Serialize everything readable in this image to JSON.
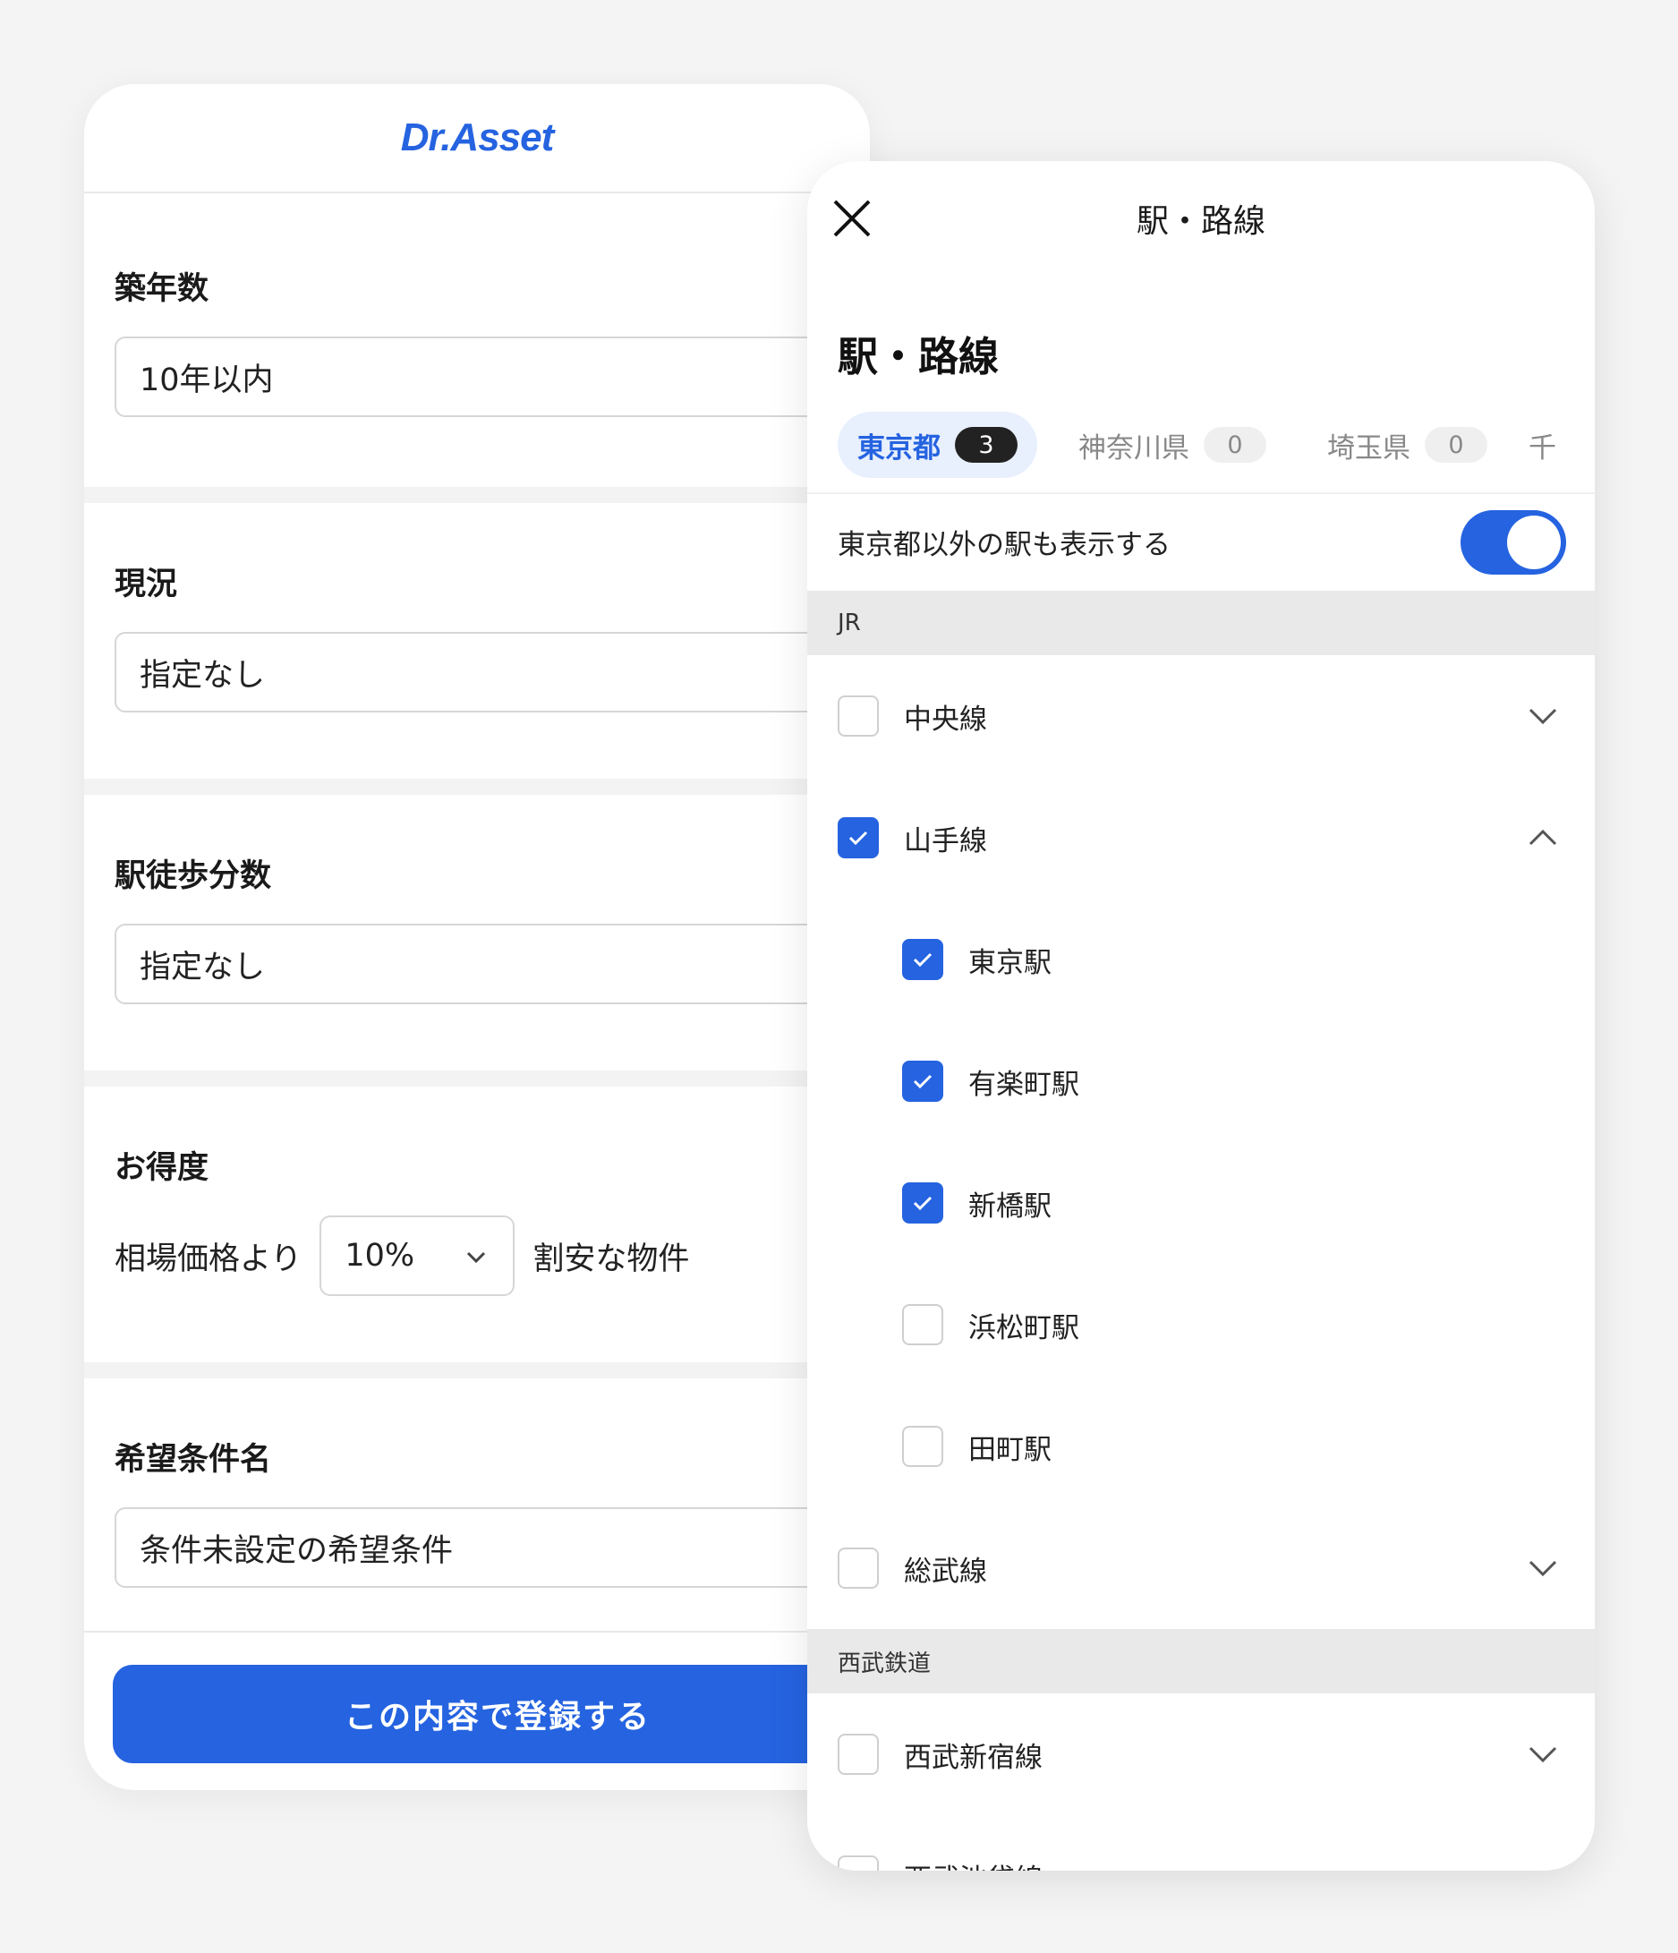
{
  "left": {
    "logo": "Dr.Asset",
    "sections": {
      "age": {
        "title": "築年数",
        "value": "10年以内"
      },
      "status": {
        "title": "現況",
        "value": "指定なし"
      },
      "walk": {
        "title": "駅徒歩分数",
        "value": "指定なし"
      },
      "deal": {
        "title": "お得度",
        "prefix": "相場価格より",
        "value": "10%",
        "suffix": "割安な物件"
      },
      "name": {
        "title": "希望条件名",
        "value": "条件未設定の希望条件"
      }
    },
    "submit_label": "この内容で登録する"
  },
  "modal": {
    "header_title": "駅・路線",
    "title": "駅・路線",
    "tabs": [
      {
        "label": "東京都",
        "count": "3",
        "active": true
      },
      {
        "label": "神奈川県",
        "count": "0",
        "active": false
      },
      {
        "label": "埼玉県",
        "count": "0",
        "active": false
      },
      {
        "label": "千",
        "count": "",
        "active": false
      }
    ],
    "toggle": {
      "label": "東京都以外の駅も表示する",
      "on": true
    },
    "groups": [
      {
        "label": "JR"
      },
      {
        "label": "西武鉄道"
      }
    ],
    "lines": {
      "chuo": {
        "label": "中央線",
        "checked": false,
        "expanded": false
      },
      "yamanote": {
        "label": "山手線",
        "checked": true,
        "expanded": true
      },
      "sobu": {
        "label": "総武線",
        "checked": false,
        "expanded": false
      },
      "seibu_shinjuku": {
        "label": "西武新宿線",
        "checked": false,
        "expanded": false
      },
      "seibu_ikebukuro": {
        "label": "西武池袋線",
        "checked": false,
        "expanded": false
      }
    },
    "stations": [
      {
        "label": "東京駅",
        "checked": true
      },
      {
        "label": "有楽町駅",
        "checked": true
      },
      {
        "label": "新橋駅",
        "checked": true
      },
      {
        "label": "浜松町駅",
        "checked": false
      },
      {
        "label": "田町駅",
        "checked": false
      }
    ]
  },
  "colors": {
    "accent": "#2563e0",
    "background": "#f4f4f4",
    "group_header": "#e9e9e9"
  },
  "icons": [
    "close-icon",
    "chevron-down-icon",
    "chevron-up-icon",
    "check-icon"
  ]
}
